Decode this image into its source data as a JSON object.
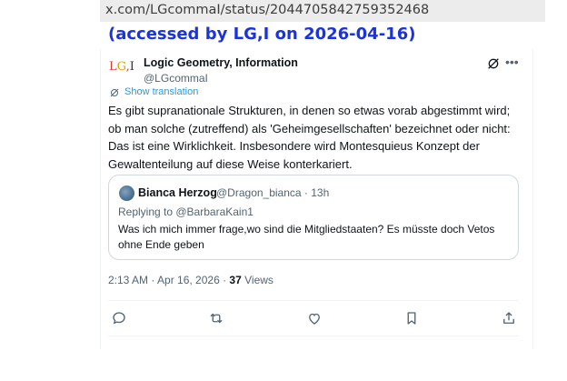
{
  "browser": {
    "url": "x.com/LGcommaI/status/2044705842759352468"
  },
  "annotation": {
    "accessed_text": "(accessed by LG,I on 2026-04-16)"
  },
  "tweet": {
    "logo_text": "LG,I",
    "author_name": "Logic Geometry, Information",
    "author_handle": "@LGcommaI",
    "translate_label": "Show translation",
    "text": "Es gibt supranationale Strukturen, in denen so etwas vorab abgestimmt wird; ob man solche (zutreffend) als 'Geheimgesellschaften' bezeichnet oder nicht: Das ist eine Wirklichkeit. Insbesondere wird Montesquieus Konzept der Gewaltenteilung auf diese Weise konterkariert.",
    "timestamp": "2:13 AM · Apr 16, 2026 · ",
    "views_count": "37",
    "views_label": " Views",
    "more_icon": "more-horizontal-icon",
    "grok_icon": "grok-icon"
  },
  "quote": {
    "author_name": "Bianca Herzog",
    "author_handle": "@Dragon_bianca · 13h",
    "replying_prefix": "Replying to ",
    "replying_to": "@BarbaraKain1",
    "text": "Was ich mich immer frage,wo sind die Mitgliedstaaten? Es müsste doch Vetos ohne Ende geben"
  },
  "actions": [
    "reply-icon",
    "repost-icon",
    "like-icon",
    "bookmark-icon",
    "share-icon"
  ],
  "colors": {
    "link": "#1d9bf0",
    "annotation": "#1a33e0",
    "secondary_text": "#536471"
  }
}
